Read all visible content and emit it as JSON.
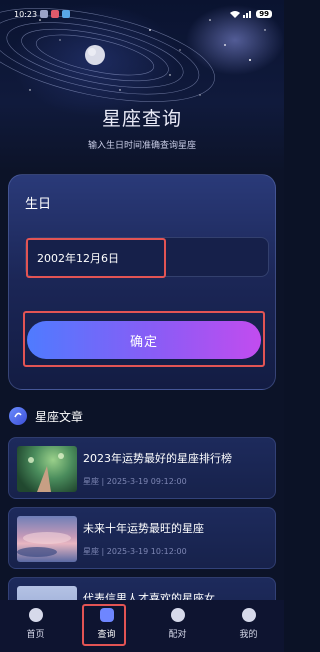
{
  "status_bar": {
    "time": "10:23",
    "battery": "99"
  },
  "hero": {
    "title": "星座查询",
    "subtitle": "输入生日时间准确查询星座"
  },
  "birthday_card": {
    "label": "生日",
    "date_value": "2002年12月6日",
    "confirm_label": "确定"
  },
  "articles_section": {
    "title": "星座文章",
    "items": [
      {
        "title": "2023年运势最好的星座排行榜",
        "meta": "星座 | 2025-3-19 09:12:00"
      },
      {
        "title": "未来十年运势最旺的星座",
        "meta": "星座 | 2025-3-19 10:12:00"
      },
      {
        "title": "代表信男人才喜欢的星座女",
        "meta": ""
      }
    ]
  },
  "nav": {
    "items": [
      {
        "label": "首页",
        "icon": "home-icon"
      },
      {
        "label": "查询",
        "icon": "search-icon"
      },
      {
        "label": "配对",
        "icon": "heart-icon"
      },
      {
        "label": "我的",
        "icon": "profile-icon"
      }
    ],
    "active_index": 1
  },
  "colors": {
    "accent_start": "#4f7bff",
    "accent_end": "#c24cef",
    "highlight": "#e25454"
  }
}
